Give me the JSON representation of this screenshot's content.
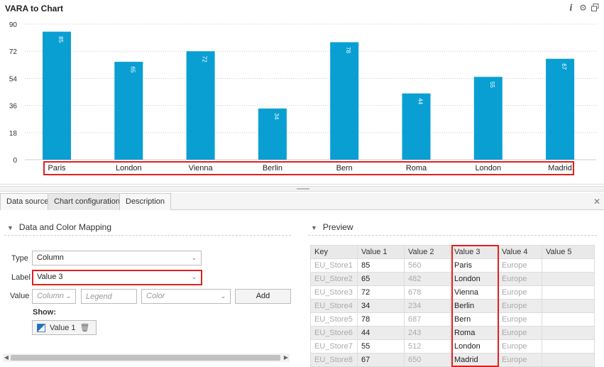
{
  "panel": {
    "title": "VARA to Chart"
  },
  "icons": {
    "info": "info-icon",
    "settings": "gear-icon",
    "window": "restore-window-icon"
  },
  "colors": {
    "bar": "#0a9fd2",
    "highlight": "#e02020",
    "grid": "#cccccc"
  },
  "chart_data": {
    "type": "bar",
    "categories": [
      "Paris",
      "London",
      "Vienna",
      "Berlin",
      "Bern",
      "Roma",
      "London",
      "Madrid"
    ],
    "values": [
      85,
      65,
      72,
      34,
      78,
      44,
      55,
      67
    ],
    "yticks": [
      "0",
      "18",
      "36",
      "54",
      "72",
      "90"
    ],
    "ylim": [
      0,
      90
    ],
    "grid": true
  },
  "tabs": [
    {
      "label": "Data source"
    },
    {
      "label": "Chart configuration"
    },
    {
      "label": "Description"
    }
  ],
  "mapping": {
    "title": "Data and Color Mapping",
    "type_label": "Type",
    "type_value": "Column",
    "label_label": "Label",
    "label_value": "Value 3",
    "value_label": "Value",
    "column_placeholder": "Column",
    "legend_placeholder": "Legend",
    "color_placeholder": "Color",
    "add_label": "Add",
    "show_label": "Show:",
    "show_item": "Value 1"
  },
  "preview": {
    "title": "Preview",
    "columns": [
      "Key",
      "Value 1",
      "Value 2",
      "Value 3",
      "Value 4",
      "Value 5"
    ],
    "rows": [
      [
        "EU_Store1",
        "85",
        "560",
        "Paris",
        "Europe",
        ""
      ],
      [
        "EU_Store2",
        "65",
        "482",
        "London",
        "Europe",
        ""
      ],
      [
        "EU_Store3",
        "72",
        "678",
        "Vienna",
        "Europe",
        ""
      ],
      [
        "EU_Store4",
        "34",
        "234",
        "Berlin",
        "Europe",
        ""
      ],
      [
        "EU_Store5",
        "78",
        "687",
        "Bern",
        "Europe",
        ""
      ],
      [
        "EU_Store6",
        "44",
        "243",
        "Roma",
        "Europe",
        ""
      ],
      [
        "EU_Store7",
        "55",
        "512",
        "London",
        "Europe",
        ""
      ],
      [
        "EU_Store8",
        "67",
        "650",
        "Madrid",
        "Europe",
        ""
      ]
    ]
  }
}
